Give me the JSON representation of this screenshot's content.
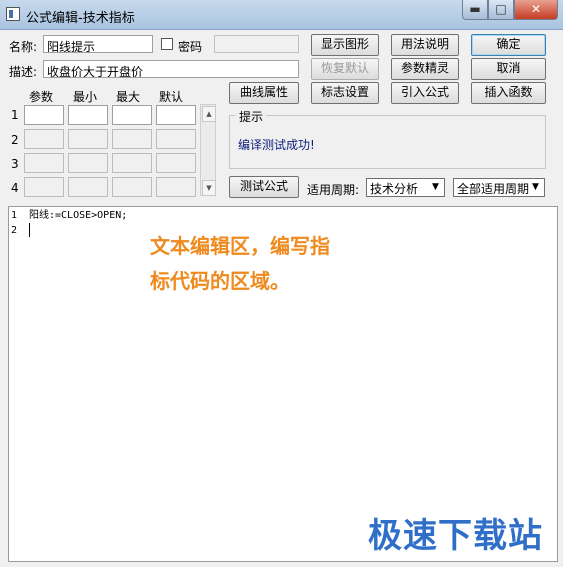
{
  "window": {
    "title": "公式编辑-技术指标",
    "minimize": "▬",
    "maximize": "□",
    "close": "✕"
  },
  "form": {
    "name_label": "名称:",
    "name_value": "阳线提示",
    "password_label": "密码",
    "password_value": "",
    "desc_label": "描述:",
    "desc_value": "收盘价大于开盘价"
  },
  "param_table": {
    "headers": [
      "参数",
      "最小",
      "最大",
      "默认"
    ],
    "row_numbers": [
      "1",
      "2",
      "3",
      "4"
    ]
  },
  "buttons": {
    "show_graph": "显示图形",
    "usage": "用法说明",
    "ok": "确定",
    "restore_default": "恢复默认",
    "param_wizard": "参数精灵",
    "cancel": "取消",
    "curve_props": "曲线属性",
    "marker_settings": "标志设置",
    "import_formula": "引入公式",
    "insert_function": "插入函数",
    "test_formula": "测试公式"
  },
  "hint": {
    "legend": "提示",
    "message": "编译测试成功!"
  },
  "period": {
    "label": "适用周期:",
    "type_value": "技术分析",
    "scope_value": "全部适用周期"
  },
  "editor": {
    "line_numbers": [
      "1",
      "2"
    ],
    "lines": [
      "阳线:=CLOSE>OPEN;",
      ""
    ]
  },
  "annotation": {
    "line1": "文本编辑区，编写指",
    "line2": "标代码的区域。"
  },
  "watermark": "极速下载站",
  "colors": {
    "annotation": "#ef8a1e",
    "watermark": "#2f6fc8",
    "hint_text": "#10217d"
  }
}
